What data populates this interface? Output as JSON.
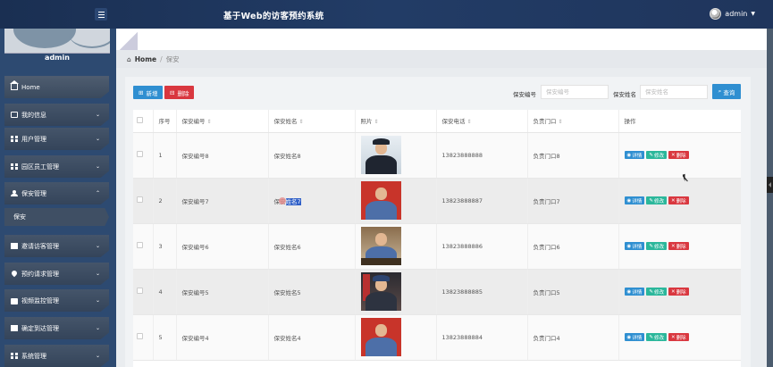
{
  "header": {
    "title": "基于Web的访客预约系统",
    "user": "admin"
  },
  "sidebar": {
    "username": "admin",
    "items": [
      {
        "label": "Home",
        "icon": "home-icon"
      },
      {
        "label": "我的信息",
        "icon": "square-icon"
      },
      {
        "label": "用户管理",
        "icon": "grid-icon"
      },
      {
        "label": "园区员工管理",
        "icon": "grid-icon"
      },
      {
        "label": "保安管理",
        "icon": "user-icon"
      },
      {
        "label": "邀请访客管理",
        "icon": "document-icon"
      },
      {
        "label": "预约请求管理",
        "icon": "pin-icon"
      },
      {
        "label": "视频监控管理",
        "icon": "briefcase-icon"
      },
      {
        "label": "确定到达管理",
        "icon": "monitor-icon"
      },
      {
        "label": "系统管理",
        "icon": "grid-icon"
      }
    ],
    "subitem": "保安"
  },
  "breadcrumb": {
    "home": "Home",
    "separator": "/",
    "current": "保安"
  },
  "toolbar": {
    "add_label": "新增",
    "delete_label": "删除",
    "search_no_label": "保安编号",
    "search_no_placeholder": "保安编号",
    "search_name_label": "保安姓名",
    "search_name_placeholder": "保安姓名",
    "search_button": "查询"
  },
  "table": {
    "columns": [
      "序号",
      "保安编号",
      "保安姓名",
      "照片",
      "保安电话",
      "负责门口",
      "操作"
    ],
    "action_labels": {
      "detail": "详情",
      "edit": "修改",
      "delete": "删除"
    },
    "rows": [
      {
        "index": "1",
        "no": "保安编号8",
        "name": "保安姓名8",
        "phone": "13823888888",
        "gate": "负责门口8",
        "photo": "studio-portrait"
      },
      {
        "index": "2",
        "no": "保安编号7",
        "name_prefix": "保安",
        "name_selected": "姓名7",
        "phone": "13823888887",
        "gate": "负责门口7",
        "photo": "red-portrait"
      },
      {
        "index": "3",
        "no": "保安编号6",
        "name": "保安姓名6",
        "phone": "13823888886",
        "gate": "负责门口6",
        "photo": "office-portrait"
      },
      {
        "index": "4",
        "no": "保安编号5",
        "name": "保安姓名5",
        "phone": "13823888885",
        "gate": "负责门口5",
        "photo": "flag-portrait"
      },
      {
        "index": "5",
        "no": "保安编号4",
        "name": "保安姓名4",
        "phone": "13823888884",
        "gate": "负责门口4",
        "photo": "red-portrait"
      }
    ]
  }
}
